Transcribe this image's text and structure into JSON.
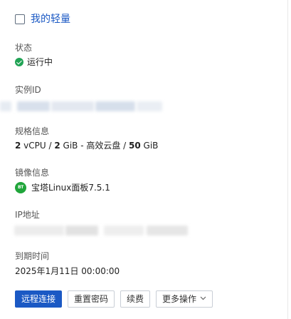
{
  "header": {
    "title": "我的轻量"
  },
  "status": {
    "label": "状态",
    "value": "运行中",
    "color": "#21a355"
  },
  "instance": {
    "label": "实例ID"
  },
  "spec": {
    "label": "规格信息",
    "cpu": "2",
    "cpu_unit": " vCPU / ",
    "mem": "2",
    "mem_unit": " GiB - 高效云盘 / ",
    "disk": "50",
    "disk_unit": " GiB"
  },
  "image": {
    "label": "镜像信息",
    "icon_text": "BT",
    "value": "宝塔Linux面板7.5.1"
  },
  "ip": {
    "label": "IP地址"
  },
  "expire": {
    "label": "到期时间",
    "value": "2025年1月11日 00:00:00"
  },
  "buttons": {
    "remote": "远程连接",
    "reset_password": "重置密码",
    "renew": "续费",
    "more": "更多操作"
  },
  "colors": {
    "primary": "#1b59c4",
    "success": "#21a355"
  }
}
